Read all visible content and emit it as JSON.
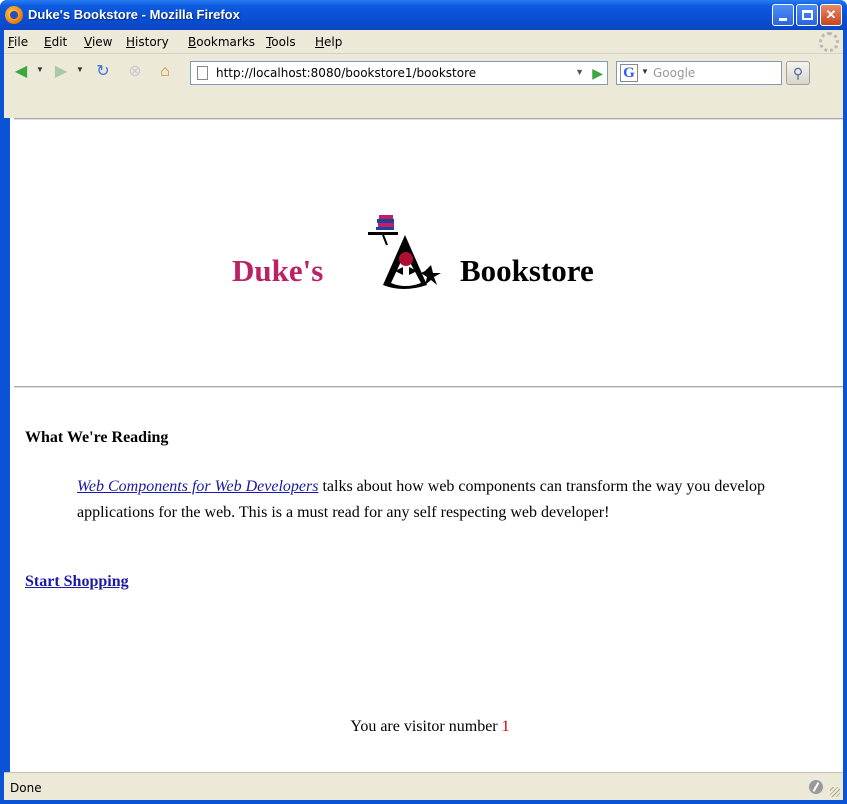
{
  "window": {
    "title": "Duke's Bookstore - Mozilla Firefox",
    "controls": {
      "minimize": "minimize",
      "maximize": "maximize",
      "close": "✕"
    }
  },
  "menubar": {
    "items": [
      "File",
      "Edit",
      "View",
      "History",
      "Bookmarks",
      "Tools",
      "Help"
    ]
  },
  "toolbar": {
    "url": "http://localhost:8080/bookstore1/bookstore",
    "search_placeholder": "Google",
    "search_engine_letter": "G"
  },
  "page": {
    "brand_left": "Duke's",
    "brand_right": "Bookstore",
    "section_heading": "What We're Reading",
    "featured_book_link": "Web Components for Web Developers",
    "featured_book_text": " talks about how web components can transform the way you develop applications for the web. This is a must read for any self respecting web developer!",
    "start_shopping": "Start Shopping",
    "visitor_label": "You are visitor number ",
    "visitor_number": "1"
  },
  "statusbar": {
    "text": "Done"
  },
  "colors": {
    "brand_magenta": "#bb2266",
    "link_blue": "#1a1aa6",
    "visitor_number": "#cc0000"
  }
}
